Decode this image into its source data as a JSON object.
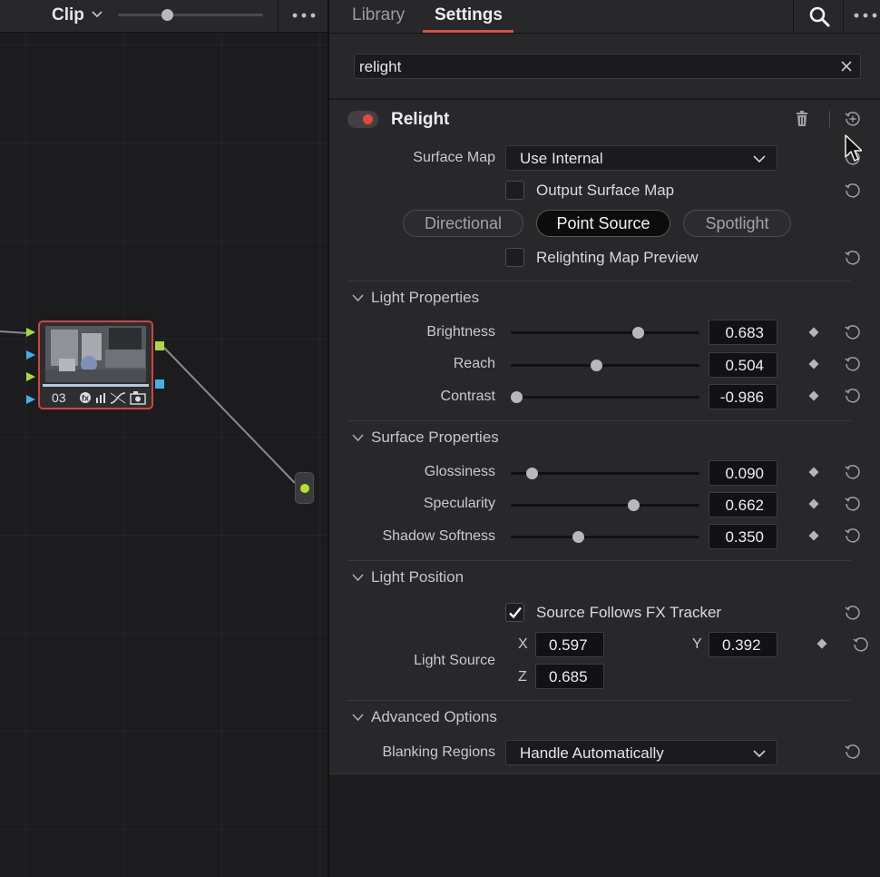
{
  "node_editor": {
    "clip_label": "Clip",
    "node_number": "03",
    "colors": {
      "node_border": "#d2443a",
      "port_green": "#a9d93a",
      "port_blue": "#3fb0e8",
      "output_dot": "#b4e22b"
    }
  },
  "tabs": {
    "library": "Library",
    "settings": "Settings"
  },
  "search": {
    "value": "relight"
  },
  "effect": {
    "title": "Relight",
    "enabled": true,
    "surface_map": {
      "label": "Surface Map",
      "value": "Use Internal"
    },
    "output_surface_map": {
      "label": "Output Surface Map",
      "checked": false
    },
    "light_types": [
      {
        "label": "Directional",
        "selected": false
      },
      {
        "label": "Point Source",
        "selected": true
      },
      {
        "label": "Spotlight",
        "selected": false
      }
    ],
    "relighting_map_preview": {
      "label": "Relighting Map Preview",
      "checked": false
    }
  },
  "sections": {
    "light_properties": {
      "title": "Light Properties",
      "params": [
        {
          "label": "Brightness",
          "value": "0.683",
          "slider": 0.683
        },
        {
          "label": "Reach",
          "value": "0.504",
          "slider": 0.45
        },
        {
          "label": "Contrast",
          "value": "-0.986",
          "slider": 0.007
        }
      ]
    },
    "surface_properties": {
      "title": "Surface Properties",
      "params": [
        {
          "label": "Glossiness",
          "value": "0.090",
          "slider": 0.09
        },
        {
          "label": "Specularity",
          "value": "0.662",
          "slider": 0.662
        },
        {
          "label": "Shadow Softness",
          "value": "0.350",
          "slider": 0.35
        }
      ]
    },
    "light_position": {
      "title": "Light Position",
      "follow_tracker": {
        "label": "Source Follows FX Tracker",
        "checked": true
      },
      "light_source_label": "Light Source",
      "x": {
        "axis": "X",
        "value": "0.597"
      },
      "y": {
        "axis": "Y",
        "value": "0.392"
      },
      "z": {
        "axis": "Z",
        "value": "0.685"
      }
    },
    "advanced_options": {
      "title": "Advanced Options",
      "blanking": {
        "label": "Blanking Regions",
        "value": "Handle Automatically"
      }
    }
  },
  "icons": {
    "search": "search-icon",
    "more": "more-dots-icon",
    "clear": "close-icon",
    "trash": "trash-icon",
    "reset": "reset-icon",
    "keyframe": "keyframe-diamond-icon",
    "chevron": "chevron-down-icon",
    "check": "checkmark-icon"
  }
}
